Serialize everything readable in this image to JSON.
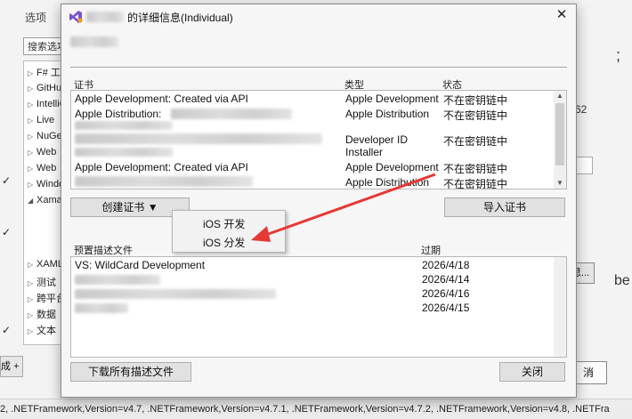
{
  "background": {
    "title": "选项",
    "search_placeholder": "搜索选项",
    "tree_items": [
      {
        "arrow": "▷",
        "label": "F# 工"
      },
      {
        "arrow": "▷",
        "label": "GitHub"
      },
      {
        "arrow": "▷",
        "label": "IntelliCode"
      },
      {
        "arrow": "▷",
        "label": "Live"
      },
      {
        "arrow": "▷",
        "label": "NuGet"
      },
      {
        "arrow": "▷",
        "label": "Web"
      },
      {
        "arrow": "▷",
        "label": "Web"
      },
      {
        "arrow": "▷",
        "label": "Windows"
      },
      {
        "arrow": "◢",
        "label": "Xamarin"
      },
      {
        "arrow": "",
        "label": ""
      },
      {
        "arrow": "▷",
        "label": "XAML"
      },
      {
        "arrow": "▷",
        "label": "测试"
      },
      {
        "arrow": "▷",
        "label": "跨平台"
      },
      {
        "arrow": "▷",
        "label": "数据"
      },
      {
        "arrow": "▷",
        "label": "文本"
      }
    ],
    "right_text_semicolon": ";",
    "right_text_62": "62",
    "right_text_be": "be",
    "right_button_label": "思...",
    "cancel_label": "消",
    "left_strip_label": "成 +",
    "footer_text": "2, .NETFramework,Version=v4.7, .NETFramework,Version=v4.7.1, .NETFramework,Version=v4.7.2, .NETFramework,Version=v4.8, .NETFra"
  },
  "dialog": {
    "title": "的详细信息(Individual)",
    "cert_section": {
      "col_cert": "证书",
      "col_type": "类型",
      "col_status": "状态",
      "rows": [
        {
          "name": "Apple Development: Created via API",
          "type": "Apple Development",
          "status": "不在密钥链中"
        },
        {
          "name": "Apple Distribution:",
          "type": "Apple Distribution",
          "status": "不在密钥链中"
        },
        {
          "name": "",
          "type": "Developer ID Installer",
          "status": "不在密钥链中"
        },
        {
          "name": "Apple Development: Created via API",
          "type": "Apple Development",
          "status": "不在密钥链中"
        },
        {
          "name": "",
          "type": "Apple Distribution",
          "status": "不在密钥链中"
        }
      ]
    },
    "create_cert_button": "创建证书 ▼",
    "import_cert_button": "导入证书",
    "dropdown": [
      "iOS 开发",
      "iOS 分发"
    ],
    "profile_section": {
      "col_profile": "预置描述文件",
      "col_expiry": "过期",
      "rows": [
        {
          "name": "VS: WildCard Development",
          "expiry": "2026/4/18"
        },
        {
          "name": "",
          "expiry": "2026/4/14"
        },
        {
          "name": "",
          "expiry": "2026/4/16"
        },
        {
          "name": "",
          "expiry": "2026/4/15"
        }
      ]
    },
    "download_button": "下载所有描述文件",
    "close_button": "关闭"
  },
  "colors": {
    "arrow": "#e53935",
    "dialog_bg": "#f6f6f6",
    "button_bg": "#e1e1e1"
  },
  "icons": {
    "app_icon": "visual-studio-icon",
    "close": "close-icon"
  }
}
